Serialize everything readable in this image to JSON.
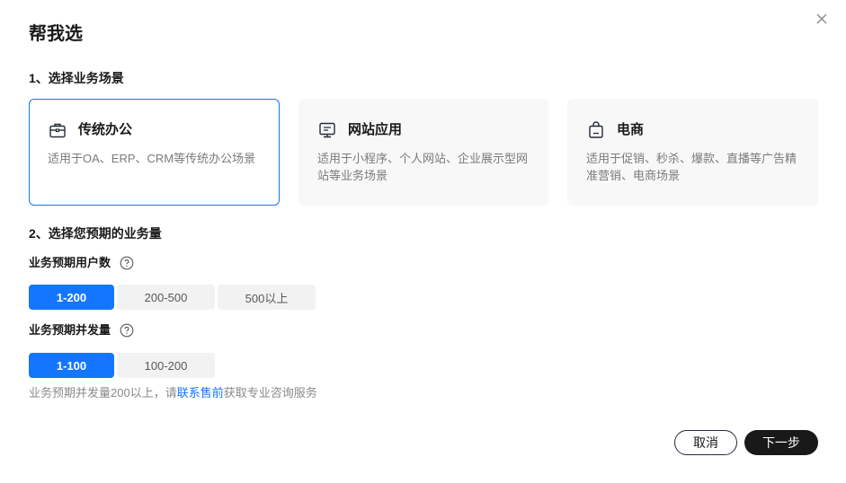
{
  "dialog": {
    "title": "帮我选",
    "close_icon": "close-icon"
  },
  "section1": {
    "title": "1、选择业务场景",
    "cards": [
      {
        "title": "传统办公",
        "desc": "适用于OA、ERP、CRM等传统办公场景",
        "icon": "briefcase-icon",
        "selected": true
      },
      {
        "title": "网站应用",
        "desc": "适用于小程序、个人网站、企业展示型网站等业务场景",
        "icon": "monitor-icon",
        "selected": false
      },
      {
        "title": "电商",
        "desc": "适用于促销、秒杀、爆款、直播等广告精准营销、电商场景",
        "icon": "shopping-bag-icon",
        "selected": false
      }
    ]
  },
  "section2": {
    "title": "2、选择您预期的业务量",
    "users": {
      "label": "业务预期用户数",
      "options": [
        "1-200",
        "200-500",
        "500以上"
      ],
      "selected": "1-200"
    },
    "concurrency": {
      "label": "业务预期并发量",
      "options": [
        "1-100",
        "100-200"
      ],
      "selected": "1-100"
    },
    "hint": {
      "prefix": "业务预期并发量200以上，请",
      "link": "联系售前",
      "suffix": "获取专业咨询服务"
    }
  },
  "footer": {
    "cancel_label": "取消",
    "next_label": "下一步"
  },
  "colors": {
    "accent": "#1476ff",
    "dark_button": "#191919",
    "card_bg": "#f8f8f8",
    "segment_bg": "#f2f2f2"
  }
}
